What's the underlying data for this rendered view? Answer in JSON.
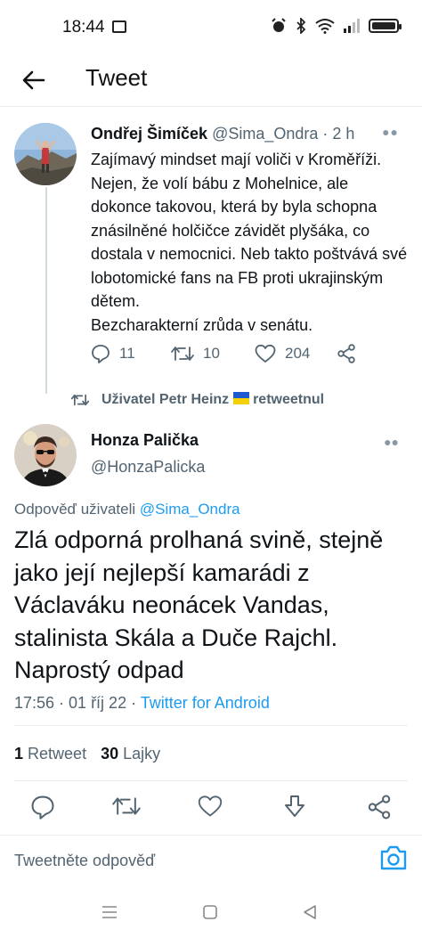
{
  "status_bar": {
    "time": "18:44"
  },
  "header": {
    "title": "Tweet"
  },
  "parent_tweet": {
    "name": "Ondřej Šimíček",
    "handle": "@Sima_Ondra",
    "age": "· 2 h",
    "text": "Zajímavý mindset mají voliči v Kroměříži.\nNejen, že volí bábu z Mohelnice, ale dokonce takovou, která by byla schopna znásilněné holčičce závidět plyšáka, co dostala v nemocnici. Neb takto poštvává své lobotomické fans na FB proti ukrajinským dětem.\nBezcharakterní zrůda v senátu.",
    "replies": "11",
    "retweets": "10",
    "likes": "204"
  },
  "retweet_note": {
    "prefix": "Uživatel Petr Heinz",
    "suffix": "retweetnul"
  },
  "main_tweet": {
    "name": "Honza Palička",
    "handle": "@HonzaPalicka",
    "reply_prefix": "Odpověď uživateli",
    "reply_handle": "@Sima_Ondra",
    "text": "Zlá odporná prolhaná svině, stejně jako její nejlepší kamarádi z Václaváku neonácek Vandas, stalinista Skála a Duče Rajchl. Naprostý odpad",
    "time_date": "17:56 · 01 říj 22 ·",
    "source": "Twitter for Android",
    "retweet_count": "1",
    "retweet_label": "Retweet",
    "like_count": "30",
    "like_label": "Lajky"
  },
  "reply_box": {
    "placeholder": "Tweetněte odpověď"
  },
  "colors": {
    "accent": "#1d9bf0",
    "muted": "#536471",
    "text": "#0f1419"
  }
}
